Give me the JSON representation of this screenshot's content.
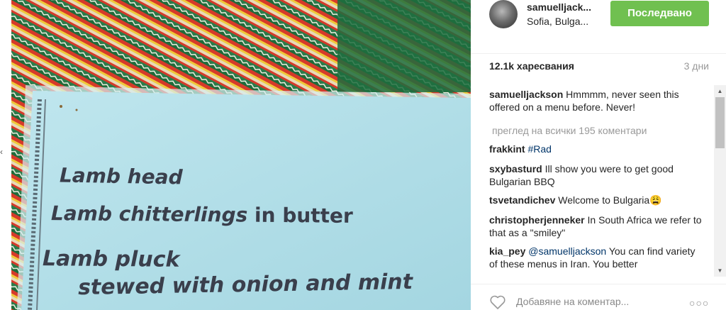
{
  "post": {
    "image_text": {
      "line1": "Lamb head",
      "line2_a": "Lamb chitterlings ",
      "line2_b": "in butter",
      "line3": "Lamb  pluck",
      "line4": "stewed with onion and mint"
    }
  },
  "header": {
    "username": "samuelljack...",
    "location": "Sofia, Bulga...",
    "follow_label": "Последвано"
  },
  "stats": {
    "likes": "12.1k харесвания",
    "time": "3 дни"
  },
  "caption": {
    "user": "samuelljackson",
    "text": " Hmmmm, never seen this offered on a menu before. Never!"
  },
  "view_all_label": "преглед на всички 195 коментари",
  "comments": [
    {
      "user": "frakkint",
      "mention": "",
      "text": "",
      "tag": " #Rad"
    },
    {
      "user": "sxybasturd",
      "mention": "",
      "text": " Ill show you were to get good Bulgarian BBQ",
      "tag": ""
    },
    {
      "user": "tsvetandichev",
      "mention": "",
      "text": " Welcome to Bulgaria😩",
      "tag": ""
    },
    {
      "user": "christopherjenneker",
      "mention": "",
      "text": " In South Africa we refer to that as a \"smiley\"",
      "tag": ""
    },
    {
      "user": "kia_pey",
      "mention": " @samuelljackson",
      "text": " You can find variety of these menus in Iran. You better",
      "tag": ""
    }
  ],
  "footer": {
    "add_comment_placeholder": "Добавяне на коментар...",
    "more_icon": "more-options-icon"
  },
  "colors": {
    "follow_bg": "#70c050",
    "link": "#003569",
    "muted": "#999999"
  }
}
